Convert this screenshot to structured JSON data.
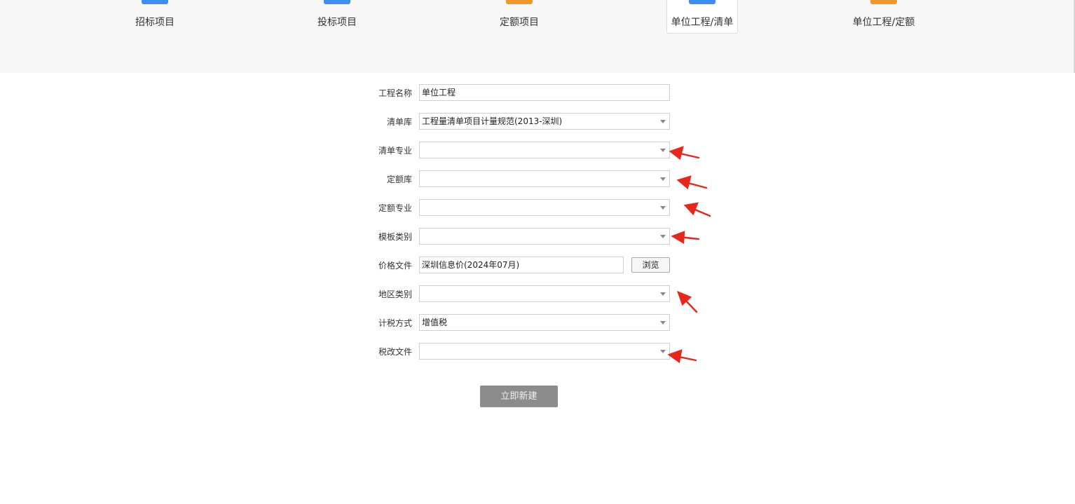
{
  "tabs": [
    {
      "label": "招标项目",
      "icon": "bid-invitation-icon",
      "color": "#3d8ef0"
    },
    {
      "label": "投标项目",
      "icon": "bid-submission-icon",
      "color": "#3d8ef0"
    },
    {
      "label": "定额项目",
      "icon": "quota-project-icon",
      "color": "#f0962a"
    },
    {
      "label": "单位工程/清单",
      "icon": "unit-bill-icon",
      "color": "#3d8ef0",
      "active": true
    },
    {
      "label": "单位工程/定额",
      "icon": "unit-quota-icon",
      "color": "#f0962a"
    }
  ],
  "form": {
    "project_name": {
      "label": "工程名称",
      "value": "单位工程"
    },
    "bill_library": {
      "label": "清单库",
      "value": "工程量清单项目计量规范(2013-深圳)"
    },
    "bill_specialty": {
      "label": "清单专业",
      "value": ""
    },
    "quota_library": {
      "label": "定额库",
      "value": ""
    },
    "quota_specialty": {
      "label": "定额专业",
      "value": ""
    },
    "template_category": {
      "label": "模板类别",
      "value": ""
    },
    "price_file": {
      "label": "价格文件",
      "value": "深圳信息价(2024年07月)",
      "browse_label": "浏览"
    },
    "region_category": {
      "label": "地区类别",
      "value": ""
    },
    "tax_method": {
      "label": "计税方式",
      "value": "增值税"
    },
    "tax_reform_file": {
      "label": "税改文件",
      "value": ""
    }
  },
  "submit_label": "立即新建",
  "colors": {
    "annotation_arrow": "#e8261c",
    "submit_bg": "#8c8c8c"
  }
}
